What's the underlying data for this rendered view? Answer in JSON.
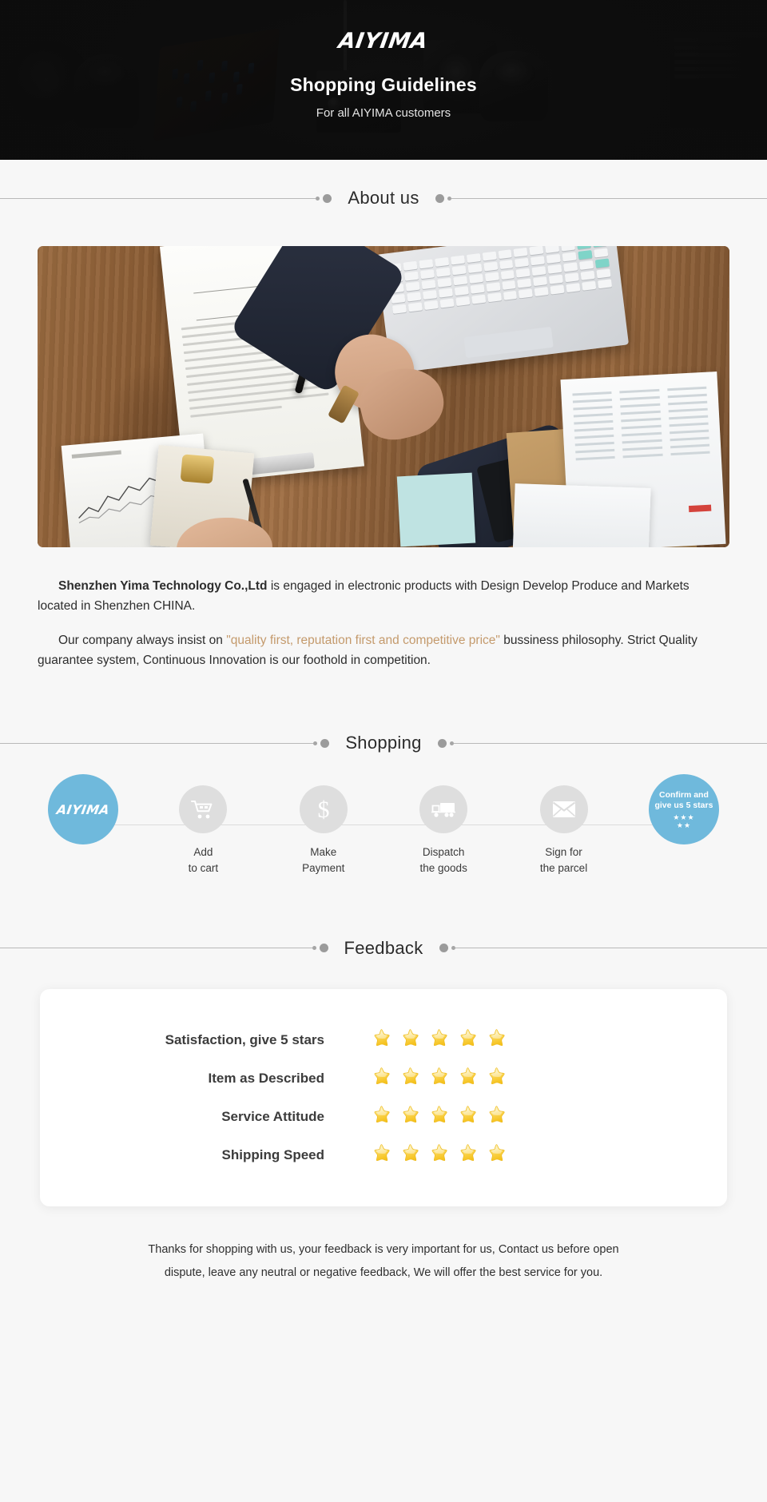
{
  "hero": {
    "brand": "AIYIMA",
    "title": "Shopping Guidelines",
    "subtitle": "For all AIYIMA customers"
  },
  "sections": {
    "about_title": "About us",
    "shopping_title": "Shopping",
    "feedback_title": "Feedback"
  },
  "about": {
    "paragraph1_strong": "Shenzhen Yima Technology Co.,Ltd",
    "paragraph1_rest": " is engaged in electronic products with Design Develop Produce and Markets located in Shenzhen CHINA.",
    "paragraph2_before": "Our company always insist on ",
    "paragraph2_quote": "\"quality first, reputation first and competitive price\"",
    "paragraph2_after": " bussiness philosophy. Strict Quality guarantee system, Continuous Innovation is our foothold in competition."
  },
  "shopping": {
    "steps": [
      {
        "icon": "aiyima-logo-icon",
        "label": "",
        "brand_text": "AIYIMA",
        "type": "brand"
      },
      {
        "icon": "shopping-cart-icon",
        "label": "Add\nto cart",
        "type": "normal"
      },
      {
        "icon": "dollar-sign-icon",
        "label": "Make\nPayment",
        "type": "normal"
      },
      {
        "icon": "delivery-truck-icon",
        "label": "Dispatch\nthe goods",
        "type": "normal"
      },
      {
        "icon": "envelope-icon",
        "label": "Sign for\nthe parcel",
        "type": "normal"
      },
      {
        "icon": "five-stars-icon",
        "label": "",
        "confirm_line1": "Confirm and",
        "confirm_line2": "give us 5 stars",
        "confirm_stars_top": "★★★",
        "confirm_stars_bottom": "★★",
        "type": "confirm"
      }
    ]
  },
  "feedback": {
    "rows": [
      {
        "label": "Satisfaction, give 5 stars",
        "stars": 5
      },
      {
        "label": "Item as Described",
        "stars": 5
      },
      {
        "label": "Service Attitude",
        "stars": 5
      },
      {
        "label": "Shipping Speed",
        "stars": 5
      }
    ]
  },
  "footer": {
    "line1": "Thanks for shopping with us, your feedback is very important for us, Contact us before open",
    "line2": "dispute, leave any neutral or negative feedback, We will offer the best service for you."
  },
  "colors": {
    "brand_blue": "#6fb9dc",
    "banner_dark": "#131313",
    "page_bg": "#f7f7f7",
    "quote_brown": "#c49a6c",
    "star_yellow": "#fbd24a"
  }
}
